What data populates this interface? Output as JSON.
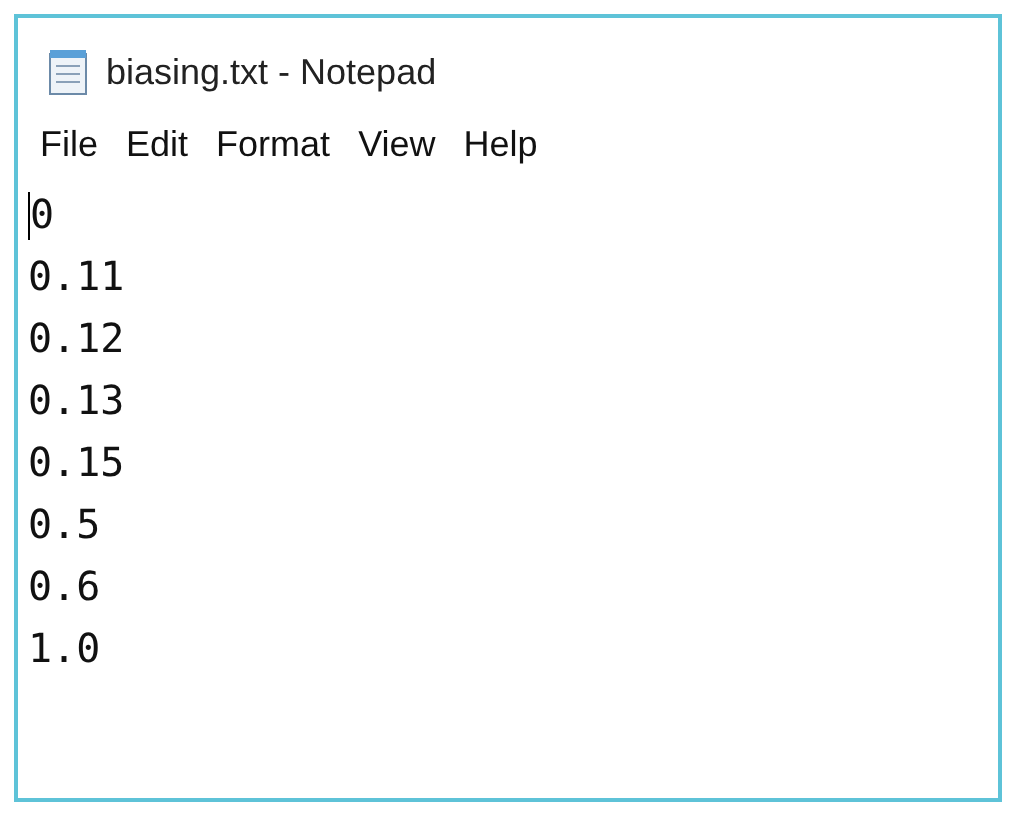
{
  "window": {
    "title": "biasing.txt - Notepad"
  },
  "menu": [
    "File",
    "Edit",
    "Format",
    "View",
    "Help"
  ],
  "editor": {
    "lines": [
      "0",
      "0.11",
      "0.12",
      "0.13",
      "0.15",
      "0.5",
      "0.6",
      "1.0"
    ]
  }
}
